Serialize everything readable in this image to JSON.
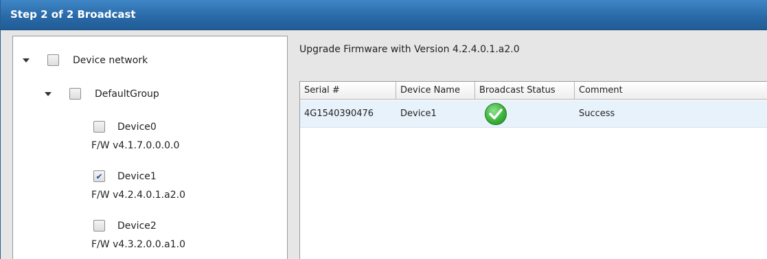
{
  "window": {
    "title": "Step 2 of 2 Broadcast"
  },
  "tree": {
    "root": {
      "label": "Device network",
      "checked": false
    },
    "group": {
      "label": "DefaultGroup",
      "checked": false
    },
    "devices": [
      {
        "name": "Device0",
        "firmware": "F/W v4.1.7.0.0.0.0",
        "checked": false
      },
      {
        "name": "Device1",
        "firmware": "F/W v4.2.4.0.1.a2.0",
        "checked": true
      },
      {
        "name": "Device2",
        "firmware": "F/W v4.3.2.0.0.a1.0",
        "checked": false
      }
    ]
  },
  "upgrade": {
    "text": "Upgrade Firmware with Version 4.2.4.0.1.a2.0"
  },
  "grid": {
    "headers": [
      "Serial #",
      "Device Name",
      "Broadcast Status",
      "Comment"
    ],
    "rows": [
      {
        "serial": "4G1540390476",
        "device_name": "Device1",
        "status_icon": "check-circle-icon",
        "comment": "Success"
      }
    ]
  },
  "colors": {
    "titlebar": "#2a6aa8",
    "selected_row": "#e8f2fb",
    "success_icon": "#3cb33c"
  }
}
